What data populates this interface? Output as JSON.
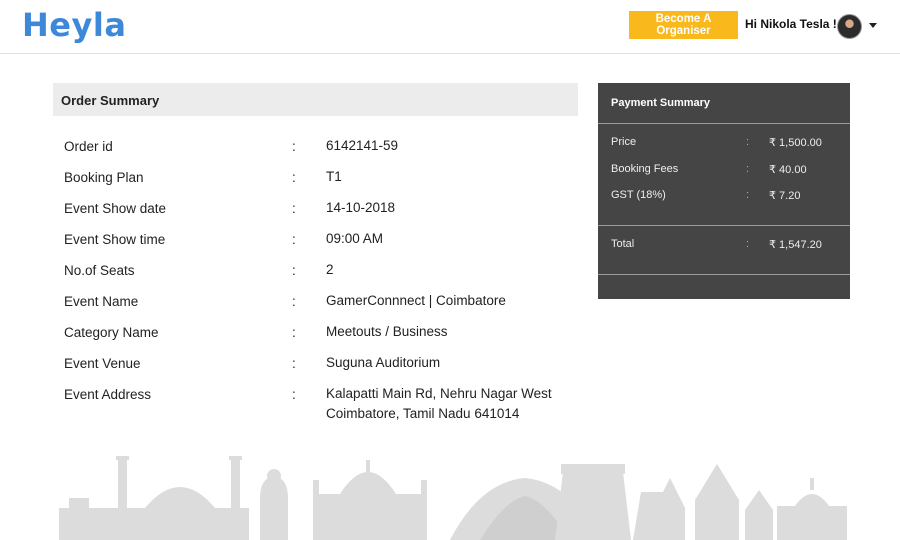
{
  "header": {
    "logo": "Heyla",
    "organiser_button": "Become A Organiser",
    "greeting": "Hi Nikola Tesla !"
  },
  "order_summary": {
    "title": "Order Summary",
    "separator": ":",
    "rows": [
      {
        "label": "Order id",
        "value": "6142141-59"
      },
      {
        "label": "Booking Plan",
        "value": "T1"
      },
      {
        "label": "Event Show date",
        "value": "14-10-2018"
      },
      {
        "label": "Event Show time",
        "value": "09:00 AM"
      },
      {
        "label": "No.of Seats",
        "value": "2"
      },
      {
        "label": "Event Name",
        "value": "GamerConnnect | Coimbatore"
      },
      {
        "label": "Category Name",
        "value": "Meetouts / Business"
      },
      {
        "label": "Event Venue",
        "value": "Suguna Auditorium"
      },
      {
        "label": "Event Address",
        "value": "Kalapatti Main Rd, Nehru Nagar West",
        "value_line2": "Coimbatore, Tamil Nadu 641014"
      }
    ]
  },
  "payment_summary": {
    "title": "Payment Summary",
    "separator": ":",
    "items": [
      {
        "label": "Price",
        "value": "₹ 1,500.00"
      },
      {
        "label": "Booking Fees",
        "value": "₹ 40.00"
      },
      {
        "label": "GST (18%)",
        "value": "₹ 7.20"
      }
    ],
    "total": {
      "label": "Total",
      "value": "₹ 1,547.20"
    }
  },
  "colors": {
    "brand": "#3d88d9",
    "organiser_button": "#f9b81c",
    "payment_panel": "#454545",
    "order_header_bg": "#ececec",
    "skyline": "#dcdcdc"
  },
  "icons": {
    "avatar": "user-avatar",
    "menu": "caret-down-icon"
  }
}
